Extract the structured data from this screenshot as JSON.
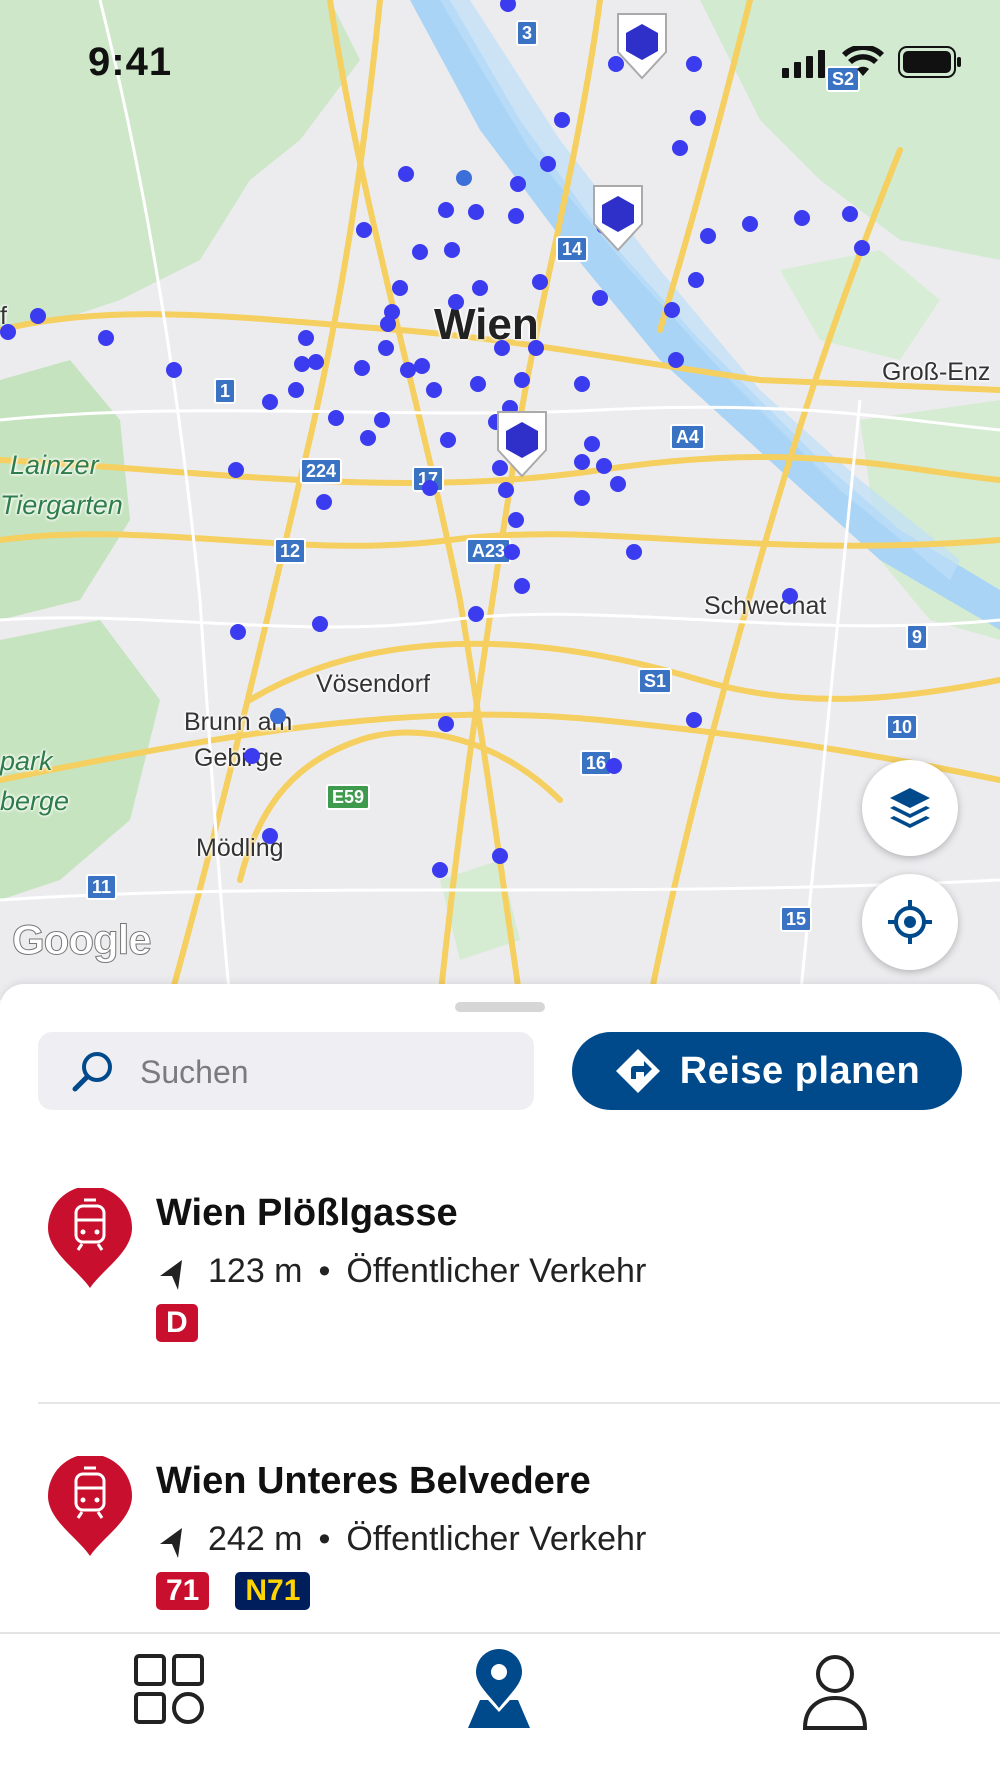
{
  "status_bar": {
    "time": "9:41"
  },
  "map": {
    "places": {
      "wien": "Wien",
      "gross_enz": "Groß-Enz",
      "lainzer": "Lainzer",
      "tiergarten": "Tiergarten",
      "schwechat": "Schwechat",
      "voesendorf": "Vösendorf",
      "brunn1": "Brunn am",
      "brunn2": "Gebirge",
      "moedling": "Mödling",
      "park": "park",
      "berge": "berge",
      "f": "f"
    },
    "shields": {
      "s3": "3",
      "s14": "14",
      "s1": "1",
      "s224": "224",
      "s17": "17",
      "s12": "12",
      "sA23": "A23",
      "sA4": "A4",
      "sS1": "S1",
      "sS2": "S2",
      "s9": "9",
      "s10": "10",
      "s16": "16",
      "sE59": "E59",
      "s11": "11",
      "s15": "15"
    },
    "attribution": "Google",
    "colors": {
      "marker": "#3d3df0",
      "road": "#f6d36b",
      "water": "#a8d4f5",
      "park": "#cfe9c8"
    }
  },
  "controls": {
    "layers_icon": "layers-icon",
    "locate_icon": "locate-icon"
  },
  "search": {
    "placeholder": "Suchen"
  },
  "plan_button": {
    "label": "Reise planen"
  },
  "results": [
    {
      "title": "Wien Plößlgasse",
      "distance": "123 m",
      "separator": "•",
      "category": "Öffentlicher Verkehr",
      "badges": [
        "D"
      ]
    },
    {
      "title": "Wien Unteres Belvedere",
      "distance": "242 m",
      "separator": "•",
      "category": "Öffentlicher Verkehr",
      "badges": [
        "71",
        "N71"
      ]
    }
  ],
  "tabs": {
    "dashboard": "dashboard-icon",
    "map": "map-pin-icon",
    "profile": "profile-icon"
  },
  "brand_colors": {
    "primary": "#004a8c",
    "station": "#c8102e"
  }
}
